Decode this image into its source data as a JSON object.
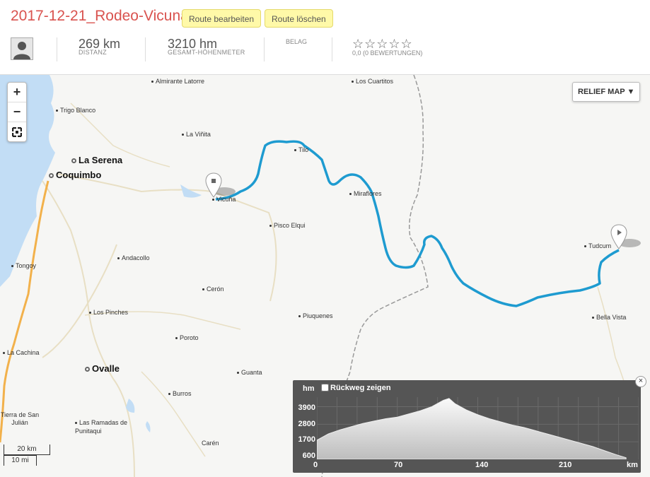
{
  "header": {
    "title": "2017-12-21_Rodeo-Vicuna",
    "edit_label": "Route bearbeiten",
    "delete_label": "Route löschen",
    "distance_value": "269 km",
    "distance_label": "DISTANZ",
    "elevation_value": "3210 hm",
    "elevation_label": "GESAMT-HÖHENMETER",
    "surface_label": "BELAG",
    "stars": "☆☆☆☆☆",
    "rating_label": "0,0 (0 BEWERTUNGEN)"
  },
  "map": {
    "zoom_in": "+",
    "zoom_out": "−",
    "fullscreen": "⛶",
    "layer_button": "RELIEF MAP ▼",
    "places": [
      {
        "name": "Almirante Latorre"
      },
      {
        "name": "Los Cuartitos"
      },
      {
        "name": "Trigo Blanco"
      },
      {
        "name": "La Viñita"
      },
      {
        "name": "La Serena"
      },
      {
        "name": "Coquimbo"
      },
      {
        "name": "Tilo"
      },
      {
        "name": "Miraflores"
      },
      {
        "name": "Vicuña"
      },
      {
        "name": "Pisco Elqui"
      },
      {
        "name": "Tudcum"
      },
      {
        "name": "Andacollo"
      },
      {
        "name": "Tongoy"
      },
      {
        "name": "Cerón"
      },
      {
        "name": "Los Pinches"
      },
      {
        "name": "Piuquenes"
      },
      {
        "name": "Bella Vista"
      },
      {
        "name": "Poroto"
      },
      {
        "name": "La Cachina"
      },
      {
        "name": "Ovalle"
      },
      {
        "name": "Guanta"
      },
      {
        "name": "Burros"
      },
      {
        "name": "Tierra de San Julián"
      },
      {
        "name": "Las Ramadas de Punitaqui"
      },
      {
        "name": "Carén"
      }
    ],
    "scale_km": "20 km",
    "scale_mi": "10 mi"
  },
  "elevation": {
    "unit_label": "hm",
    "return_label": "Rückweg zeigen",
    "close": "×",
    "yticks": [
      "3900",
      "2800",
      "1700",
      "600"
    ],
    "xticks": [
      "0",
      "70",
      "140",
      "210"
    ],
    "x_unit": "km"
  },
  "chart_data": {
    "type": "area",
    "title": "",
    "xlabel": "km",
    "ylabel": "hm",
    "xlim": [
      0,
      280
    ],
    "ylim": [
      600,
      4500
    ],
    "grid": true,
    "series": [
      {
        "x": [
          0,
          10,
          20,
          30,
          40,
          50,
          60,
          70,
          80,
          90,
          100,
          110,
          115,
          120,
          130,
          140,
          150,
          160,
          170,
          180,
          190,
          200,
          210,
          220,
          230,
          240,
          250,
          260,
          269
        ],
        "values": [
          1800,
          2200,
          2450,
          2650,
          2850,
          3000,
          3150,
          3250,
          3450,
          3650,
          3900,
          4300,
          4420,
          4100,
          3700,
          3400,
          3150,
          2950,
          2750,
          2600,
          2400,
          2200,
          2000,
          1800,
          1600,
          1400,
          1150,
          900,
          700
        ]
      }
    ]
  }
}
